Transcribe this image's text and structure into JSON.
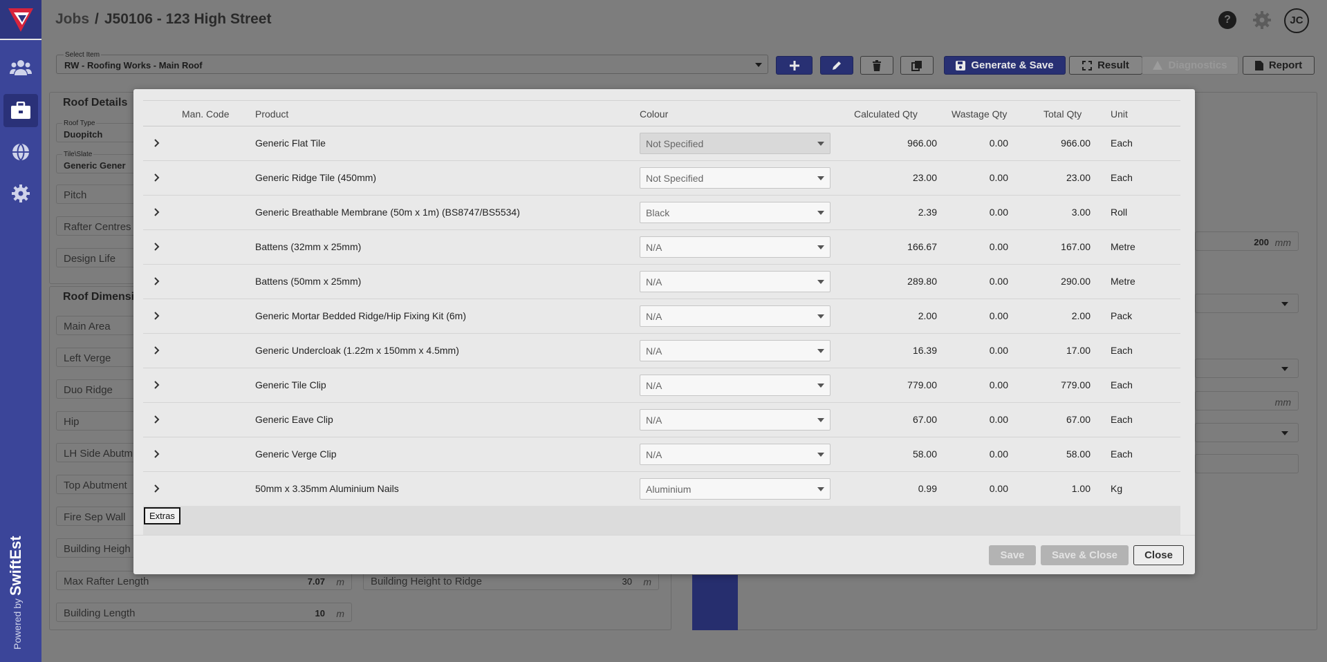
{
  "header": {
    "section": "Jobs",
    "separator": "/",
    "job": "J50106 - 123 High Street",
    "help_icon": "question-icon",
    "user_initials": "JC"
  },
  "sidebar": {
    "items": [
      {
        "icon": "users-icon"
      },
      {
        "icon": "briefcase-icon",
        "active": true
      },
      {
        "icon": "globe-icon"
      },
      {
        "icon": "gear-icon"
      }
    ],
    "powered_by": "Powered by",
    "brand": "SwiftEst"
  },
  "toolbar": {
    "select_label": "Select Item",
    "select_value": "RW - Roofing Works - Main Roof",
    "generate_save": "Generate & Save",
    "result": "Result",
    "diagnostics": "Diagnostics",
    "report": "Report"
  },
  "roof_details": {
    "title": "Roof Details",
    "roof_type_label": "Roof Type",
    "roof_type": "Duopitch",
    "tile_label": "Tile\\Slate",
    "tile": "Generic Gener",
    "pitch": "Pitch",
    "rafter_centres": "Rafter Centres",
    "design_life": "Design Life"
  },
  "roof_dimensions": {
    "title": "Roof Dimensi",
    "fields": {
      "main_area": "Main Area",
      "left_verge": "Left Verge",
      "duo_ridge": "Duo Ridge",
      "hip": "Hip",
      "lh_side": "LH Side Abutm",
      "top_abutment": "Top Abutment",
      "fire_sep": "Fire Sep Wall",
      "building_height": "Building Heigh",
      "max_rafter": "Max Rafter Length",
      "max_rafter_value": "7.07",
      "max_rafter_unit": "m",
      "building_height_ridge": "Building Height to Ridge",
      "building_height_ridge_value": "30",
      "building_height_ridge_unit": "m",
      "building_length": "Building Length",
      "building_length_value": "10",
      "building_length_unit": "m"
    }
  },
  "right_panel": {
    "value_200": "200",
    "unit_mm": "mm",
    "unit_mm2": "mm"
  },
  "modal": {
    "columns": {
      "man_code": "Man. Code",
      "product": "Product",
      "colour": "Colour",
      "calc_qty": "Calculated Qty",
      "wastage_qty": "Wastage Qty",
      "total_qty": "Total Qty",
      "unit": "Unit"
    },
    "rows": [
      {
        "product": "Generic Flat Tile",
        "colour": "Not Specified",
        "calc": "966.00",
        "waste": "0.00",
        "total": "966.00",
        "unit": "Each"
      },
      {
        "product": "Generic Ridge Tile (450mm)",
        "colour": "Not Specified",
        "calc": "23.00",
        "waste": "0.00",
        "total": "23.00",
        "unit": "Each"
      },
      {
        "product": "Generic Breathable Membrane (50m x 1m) (BS8747/BS5534)",
        "colour": "Black",
        "calc": "2.39",
        "waste": "0.00",
        "total": "3.00",
        "unit": "Roll"
      },
      {
        "product": "Battens (32mm x 25mm)",
        "colour": "N/A",
        "calc": "166.67",
        "waste": "0.00",
        "total": "167.00",
        "unit": "Metre"
      },
      {
        "product": "Battens (50mm x 25mm)",
        "colour": "N/A",
        "calc": "289.80",
        "waste": "0.00",
        "total": "290.00",
        "unit": "Metre"
      },
      {
        "product": "Generic Mortar Bedded Ridge/Hip Fixing Kit (6m)",
        "colour": "N/A",
        "calc": "2.00",
        "waste": "0.00",
        "total": "2.00",
        "unit": "Pack"
      },
      {
        "product": "Generic Undercloak (1.22m x 150mm x 4.5mm)",
        "colour": "N/A",
        "calc": "16.39",
        "waste": "0.00",
        "total": "17.00",
        "unit": "Each"
      },
      {
        "product": "Generic Tile Clip",
        "colour": "N/A",
        "calc": "779.00",
        "waste": "0.00",
        "total": "779.00",
        "unit": "Each"
      },
      {
        "product": "Generic Eave Clip",
        "colour": "N/A",
        "calc": "67.00",
        "waste": "0.00",
        "total": "67.00",
        "unit": "Each"
      },
      {
        "product": "Generic Verge Clip",
        "colour": "N/A",
        "calc": "58.00",
        "waste": "0.00",
        "total": "58.00",
        "unit": "Each"
      },
      {
        "product": "50mm x 3.35mm Aluminium Nails",
        "colour": "Aluminium",
        "calc": "0.99",
        "waste": "0.00",
        "total": "1.00",
        "unit": "Kg"
      }
    ],
    "extras": "Extras",
    "save": "Save",
    "save_close": "Save & Close",
    "close": "Close"
  }
}
